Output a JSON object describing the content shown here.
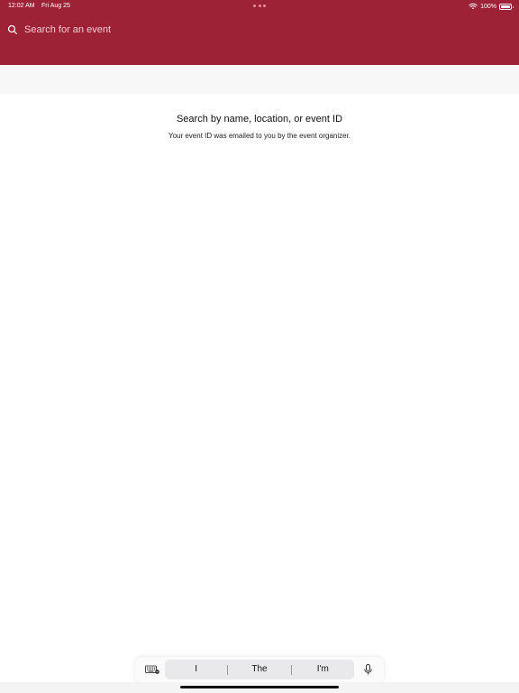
{
  "status_bar": {
    "time": "12:02 AM",
    "date": "Fri Aug 25",
    "battery": "100%",
    "icons": [
      "wifi-icon",
      "battery-icon",
      "multitasking-dots-icon"
    ]
  },
  "search": {
    "placeholder": "Search for an event",
    "value": "",
    "icon": "search-icon"
  },
  "empty_state": {
    "title": "Search by name, location, or event ID",
    "subtitle": "Your event ID was emailed to you by the event organizer."
  },
  "keyboard_bar": {
    "suggestions": [
      "I",
      "The",
      "I'm"
    ],
    "icons": [
      "keyboard-icon",
      "microphone-icon"
    ]
  },
  "colors": {
    "header_background": "#9d2236",
    "subbar_background": "#f7f7f7",
    "page_background": "#ffffff"
  }
}
